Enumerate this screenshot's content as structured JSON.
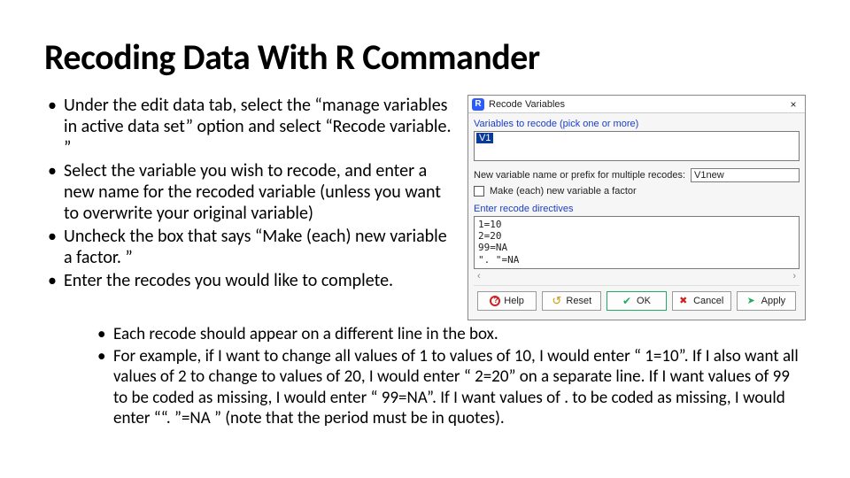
{
  "title": "Recoding Data With R Commander",
  "bullets": [
    "Under the edit data tab, select the “manage variables in active data set” option and select “Recode variable. ”",
    "Select the variable you wish to recode, and enter a new name for the recoded variable (unless you want to overwrite your original variable)",
    "Uncheck the box that says “Make (each) new variable a factor. ”",
    "Enter the recodes you would like to complete."
  ],
  "sub_bullets": [
    "Each recode should appear on a different line in the box.",
    "For example, if I want to change all values of 1 to values of 10, I would enter “ 1=10”. If I also want all values of 2 to change to values of 20, I would enter “ 2=20” on a separate line. If I want values of 99 to be coded as missing, I would enter “ 99=NA”. If I want values of . to be coded as missing, I would enter ““. ”=NA ” (note that the period must be in quotes)."
  ],
  "dialog": {
    "title": "Recode Variables",
    "r_icon": "R",
    "close": "×",
    "vars_label": "Variables to recode (pick one or more)",
    "selected_var": "V1",
    "new_name_label": "New variable name or prefix for multiple recodes:",
    "new_name_value": "V1new",
    "factor_label": "Make (each) new variable a factor",
    "directives_label": "Enter recode directives",
    "directives_text": "1=10\n2=20\n99=NA\n\". \"=NA",
    "scroll_left": "‹",
    "scroll_right": "›",
    "buttons": {
      "help": "Help",
      "reset": "Reset",
      "ok": "OK",
      "cancel": "Cancel",
      "apply": "Apply"
    }
  }
}
